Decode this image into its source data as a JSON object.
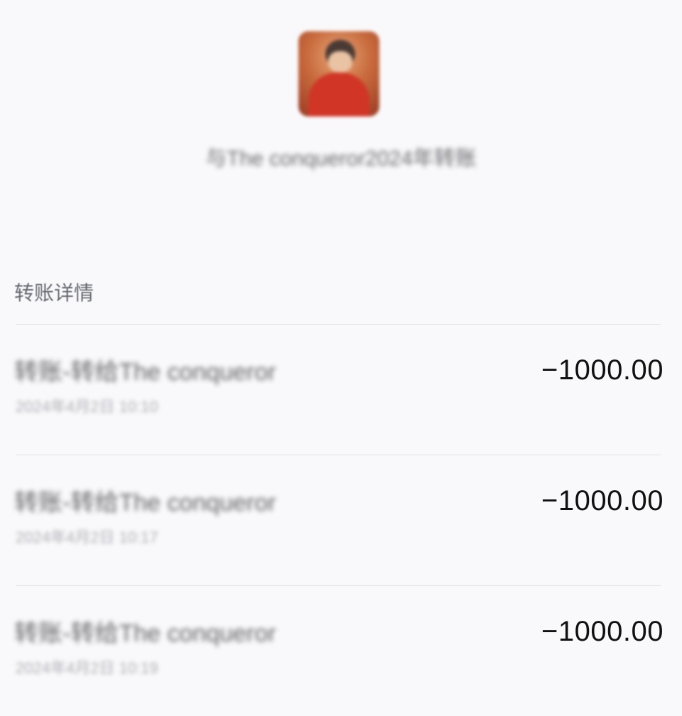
{
  "header": {
    "avatar_icon": "user-avatar-icon",
    "subtitle": "与The conqueror2024年转账"
  },
  "section": {
    "title": "转账详情"
  },
  "transactions": [
    {
      "name": "转账-转给The conqueror",
      "time": "2024年4月2日 10:10",
      "amount": "−1000.00"
    },
    {
      "name": "转账-转给The conqueror",
      "time": "2024年4月2日 10:17",
      "amount": "−1000.00"
    },
    {
      "name": "转账-转给The conqueror",
      "time": "2024年4月2日 10:19",
      "amount": "−1000.00"
    }
  ]
}
